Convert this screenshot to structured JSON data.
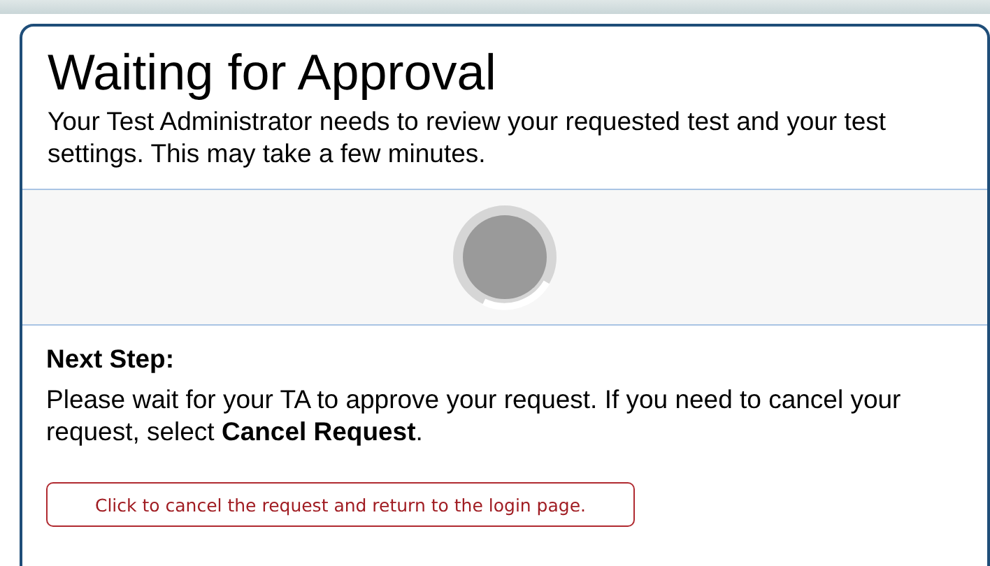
{
  "dialog": {
    "title": "Waiting for Approval",
    "message": "Your Test Administrator needs to review your requested test and your test settings. This may take a few minutes.",
    "next_step": {
      "heading": "Next Step:",
      "text": "Please wait for your TA to approve your request. If you need to cancel your request, select **Cancel Request**."
    },
    "cancel_button": "Click to cancel the request and return to the login page."
  }
}
